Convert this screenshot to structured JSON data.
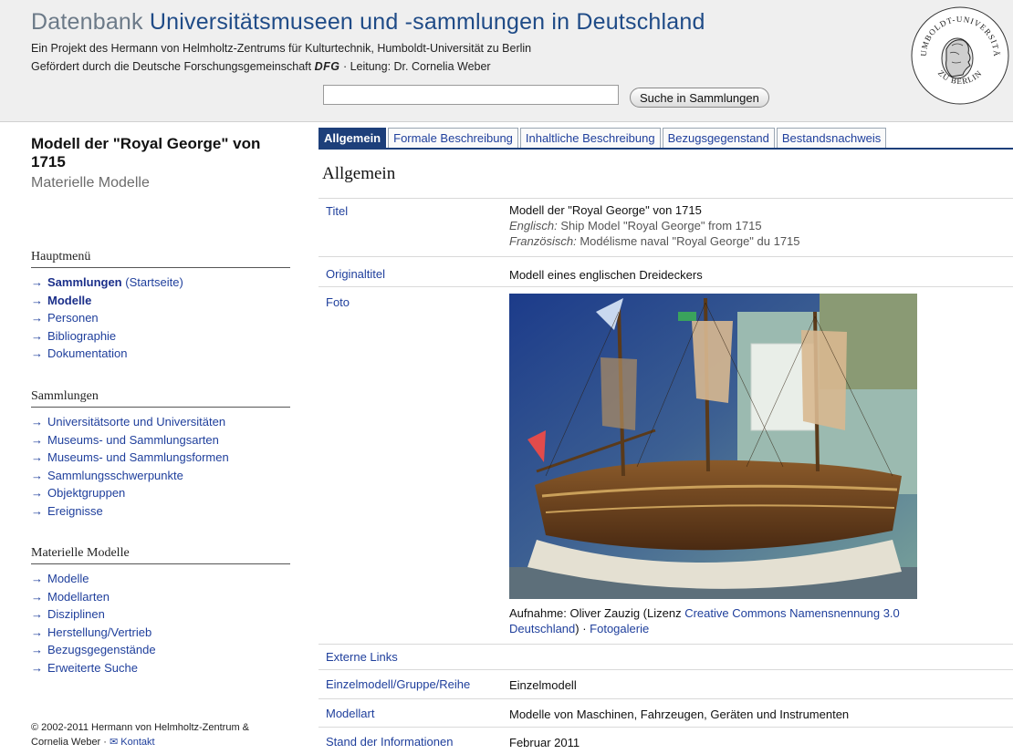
{
  "header": {
    "title_part1": "Datenbank",
    "title_part2": "Universitätsmuseen und -sammlungen in Deutschland",
    "line1": "Ein Projekt des Hermann von Helmholtz-Zentrums für Kulturtechnik, Humboldt-Universität zu Berlin",
    "line2_pre": "Gefördert durch die Deutsche Forschungsgemeinschaft ",
    "line2_dfg": "DFG",
    "line2_post": " · Leitung: Dr. Cornelia Weber",
    "search_value": "",
    "search_button": "Suche in Sammlungen",
    "seal_text_top": "HUMBOLDT-UNIVERSITÄT",
    "seal_text_bottom": "ZU BERLIN"
  },
  "sidebar": {
    "object_title": "Modell der \"Royal George\" von 1715",
    "object_category": "Materielle Modelle",
    "hauptmenu": {
      "heading": "Hauptmenü",
      "items": [
        {
          "label": "Sammlungen",
          "suffix": " (Startseite)"
        },
        {
          "label": "Modelle"
        },
        {
          "label": "Personen"
        },
        {
          "label": "Bibliographie"
        },
        {
          "label": "Dokumentation"
        }
      ]
    },
    "sammlungen": {
      "heading": "Sammlungen",
      "items": [
        {
          "label": "Universitätsorte und Universitäten"
        },
        {
          "label": "Museums- und Sammlungsarten"
        },
        {
          "label": "Museums- und Sammlungsformen"
        },
        {
          "label": "Sammlungsschwerpunkte"
        },
        {
          "label": "Objektgruppen"
        },
        {
          "label": "Ereignisse"
        }
      ]
    },
    "modelle": {
      "heading": "Materielle Modelle",
      "items": [
        {
          "label": "Modelle"
        },
        {
          "label": "Modellarten"
        },
        {
          "label": "Disziplinen"
        },
        {
          "label": "Herstellung/Vertrieb"
        },
        {
          "label": "Bezugsgegenstände"
        },
        {
          "label": "Erweiterte Suche"
        }
      ]
    },
    "footer_line1": "© 2002-2011 Hermann von Helmholtz-Zentrum &",
    "footer_line2": "Cornelia Weber · ",
    "footer_contact": "Kontakt",
    "arrow": "→",
    "mail_icon": "✉"
  },
  "tabs": [
    {
      "label": "Allgemein",
      "active": true
    },
    {
      "label": "Formale Beschreibung"
    },
    {
      "label": "Inhaltliche Beschreibung"
    },
    {
      "label": "Bezugsgegenstand"
    },
    {
      "label": "Bestandsnachweis"
    }
  ],
  "main": {
    "section_title": "Allgemein",
    "rows": {
      "titel": {
        "label": "Titel",
        "value": "Modell der \"Royal George\" von 1715",
        "en_label": "Englisch:",
        "en_value": " Ship Model \"Royal George\" from 1715",
        "fr_label": "Französisch:",
        "fr_value": " Modélisme naval \"Royal George\" du 1715"
      },
      "originaltitel": {
        "label": "Originaltitel",
        "value": "Modell eines englischen Dreideckers"
      },
      "foto": {
        "label": "Foto",
        "caption_pre": "Aufnahme: Oliver Zauzig (Lizenz ",
        "caption_link1": "Creative Commons Namensnennung 3.0",
        "caption_link1b": "Deutschland",
        "caption_mid": ") · ",
        "caption_link2": "Fotogalerie"
      },
      "externe_links": {
        "label": "Externe Links",
        "value": ""
      },
      "einzelmodell": {
        "label": "Einzelmodell/Gruppe/Reihe",
        "value": "Einzelmodell"
      },
      "modellart": {
        "label": "Modellart",
        "value": "Modelle von Maschinen, Fahrzeugen, Geräten und Instrumenten"
      },
      "stand": {
        "label": "Stand der Informationen",
        "value": "Februar 2011"
      }
    }
  },
  "colors": {
    "link": "#1f3f9c",
    "tab_active": "#1d3f7a",
    "header_bg": "#efefef"
  }
}
